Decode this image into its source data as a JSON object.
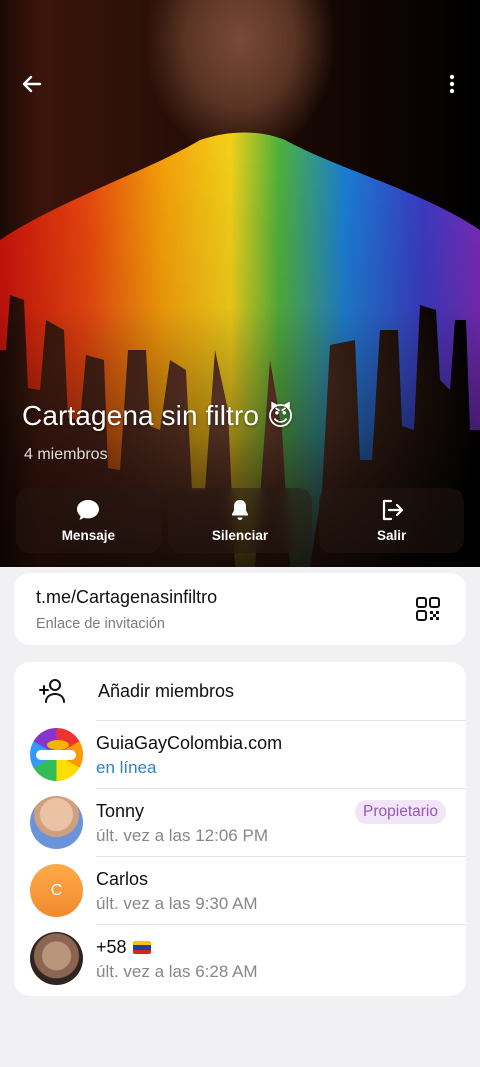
{
  "header": {
    "group_title": "Cartagena sin filtro",
    "title_emoji": "😈",
    "members_count": "4 miembros"
  },
  "actions": [
    {
      "label": "Mensaje",
      "icon": "chat-bubble-icon"
    },
    {
      "label": "Silenciar",
      "icon": "bell-icon"
    },
    {
      "label": "Salir",
      "icon": "exit-icon"
    }
  ],
  "invite": {
    "link": "t.me/Cartagenasinfiltro",
    "description": "Enlace de invitación"
  },
  "members_section": {
    "add_label": "Añadir miembros",
    "members": [
      {
        "name": "GuiaGayColombia.com",
        "status": "en línea",
        "online": true
      },
      {
        "name": "Tonny",
        "status": "últ. vez a las 12:06 PM",
        "badge": "Propietario"
      },
      {
        "name": "Carlos",
        "status": "últ. vez a las 9:30 AM",
        "initial": "C"
      },
      {
        "name": "+58",
        "status": "últ. vez a las 6:28 AM",
        "flag": "venezuela-flag"
      }
    ]
  },
  "colors": {
    "accent_blue": "#2f7fc9",
    "badge_bg": "#f1e6f7",
    "badge_text": "#9a55b8",
    "avatar_orange": "#f2892f"
  }
}
